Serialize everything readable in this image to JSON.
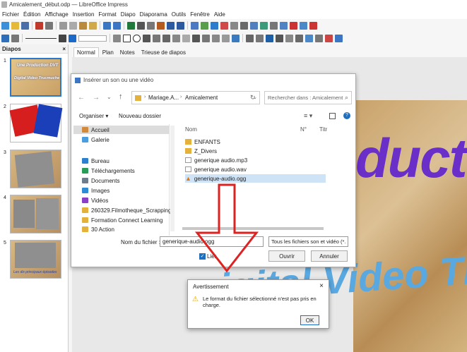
{
  "window": {
    "title": "Amicalement_début.odp — LibreOffice Impress"
  },
  "menu": [
    "Fichier",
    "Édition",
    "Affichage",
    "Insertion",
    "Format",
    "Diapo",
    "Diaporama",
    "Outils",
    "Fenêtre",
    "Aide"
  ],
  "slides_panel": {
    "title": "Diapos",
    "slide_numbers": [
      "1",
      "2",
      "3",
      "4",
      "5"
    ],
    "slide1_text_a": "Une Production DVT",
    "slide1_text_b": "Digital Video Trucmuche",
    "slide5_text": "Les dix principaux épisodes"
  },
  "view_tabs": [
    "Normal",
    "Plan",
    "Notes",
    "Trieuse de diapos"
  ],
  "slide": {
    "line1": "duction",
    "line2": "igital Video Trucmu"
  },
  "dialog": {
    "title": "Insérer un son ou une vidéo",
    "breadcrumb": [
      "Mariage.A...",
      "Amicalement"
    ],
    "search_placeholder": "Rechercher dans : Amicalement",
    "organize": "Organiser",
    "new_folder": "Nouveau dossier",
    "nav": [
      "Accueil",
      "Galerie",
      "Bureau",
      "Téléchargements",
      "Documents",
      "Images",
      "Vidéos",
      "260329.Filmotheque_Scrapping",
      "Formation Connect Learning",
      "30 Action"
    ],
    "columns": [
      "Nom",
      "N°",
      "Titr"
    ],
    "files": [
      "ENFANTS",
      "Z_Divers",
      "generique audio.mp3",
      "generique audio.wav",
      "generique-audio.ogg"
    ],
    "filename_label": "Nom du fichier :",
    "filename_value": "generique-audio.ogg",
    "filter_value": "Tous les fichiers son et vidéo (*.",
    "link_label": "Lier",
    "open_label": "Ouvrir",
    "cancel_label": "Annuler"
  },
  "alert": {
    "title": "Avertissement",
    "message": "Le format du fichier sélectionné n'est pas pris en charge.",
    "ok": "OK"
  }
}
